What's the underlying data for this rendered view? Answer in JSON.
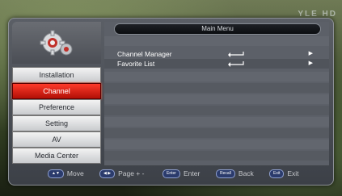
{
  "watermark": "YLE HD",
  "left_menu": {
    "items": [
      {
        "label": "Installation",
        "active": false
      },
      {
        "label": "Channel",
        "active": true
      },
      {
        "label": "Preference",
        "active": false
      },
      {
        "label": "Setting",
        "active": false
      },
      {
        "label": "AV",
        "active": false
      },
      {
        "label": "Media Center",
        "active": false
      }
    ]
  },
  "main": {
    "title": "Main Menu",
    "rows": [
      {
        "label": "Channel Manager"
      },
      {
        "label": "Favorite List"
      }
    ]
  },
  "hints": [
    {
      "key": "▲▼",
      "label": "Move"
    },
    {
      "key": "◀ ▶",
      "label": "Page + -"
    },
    {
      "key": "Enter",
      "label": "Enter"
    },
    {
      "key": "Recall",
      "label": "Back"
    },
    {
      "key": "Exit",
      "label": "Exit"
    }
  ],
  "colors": {
    "active_item": "#d41a0f",
    "panel": "#4a4e55"
  }
}
